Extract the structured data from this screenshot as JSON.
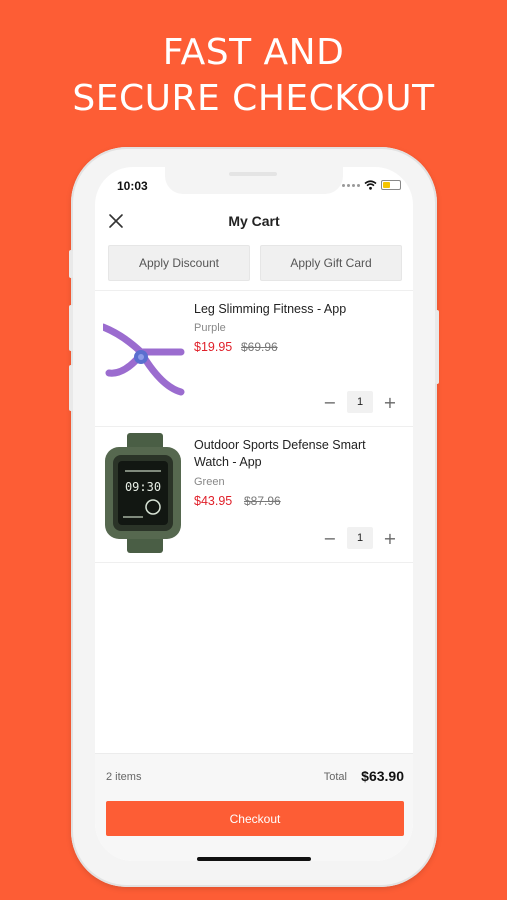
{
  "promo": {
    "line1": "FAST AND",
    "line2": "SECURE CHECKOUT"
  },
  "status_bar": {
    "time": "10:03",
    "icons": [
      "signal-dots-icon",
      "wifi-icon",
      "battery-icon"
    ]
  },
  "header": {
    "title": "My Cart",
    "close_icon": "close-icon"
  },
  "actions": {
    "discount_label": "Apply Discount",
    "gift_card_label": "Apply Gift Card"
  },
  "cart_items": [
    {
      "name": "Leg Slimming Fitness - App",
      "variant": "Purple",
      "price": "$19.95",
      "original_price": "$69.96",
      "quantity": "1"
    },
    {
      "name": "Outdoor Sports Defense Smart Watch - App",
      "variant": "Green",
      "price": "$43.95",
      "original_price": "$87.96",
      "quantity": "1"
    }
  ],
  "summary": {
    "items_count": "2 items",
    "total_label": "Total",
    "total_value": "$63.90",
    "checkout_label": "Checkout"
  },
  "watch_face": {
    "time": "09:30"
  },
  "colors": {
    "accent": "#fd5d35",
    "sale_price": "#e0202a",
    "product_purple": "#9b6ccf",
    "product_green": "#4a5e45"
  }
}
